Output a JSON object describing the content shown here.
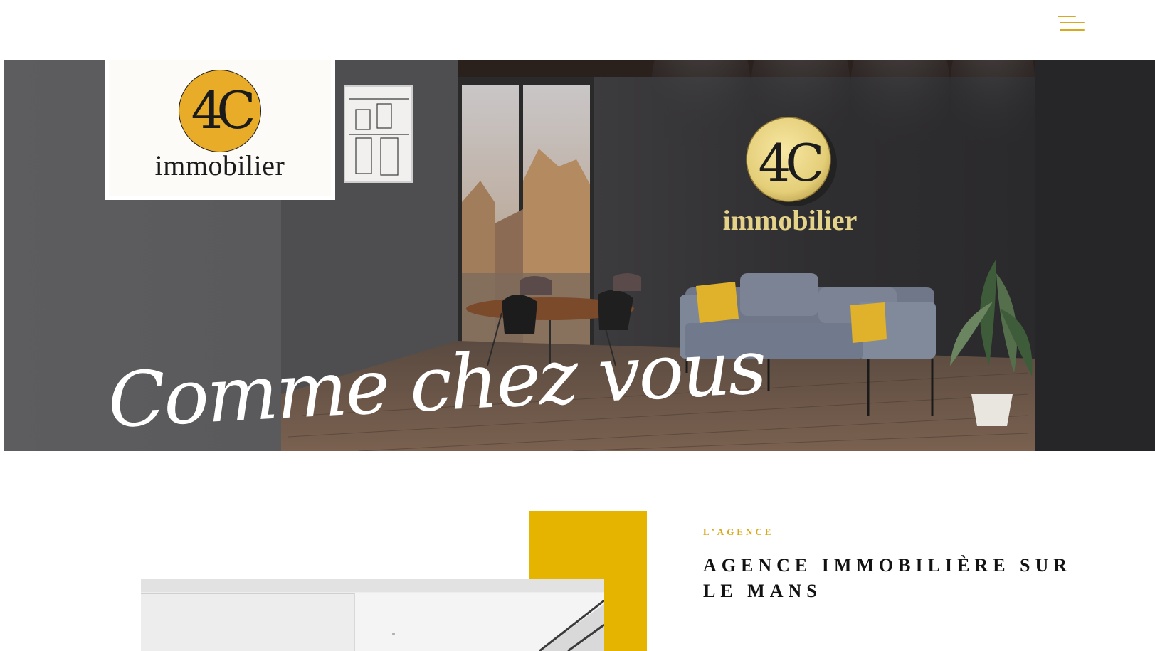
{
  "header": {
    "menu_icon": "hamburger-menu-icon",
    "accent_color": "#d7a91c"
  },
  "brand": {
    "logo_mark": "4C",
    "logo_word": "immobilier",
    "logo_color": "#e9ac29"
  },
  "hero": {
    "tagline": "Comme chez vous",
    "wall_logo_mark": "4C",
    "wall_logo_word": "immobilier"
  },
  "about": {
    "eyebrow": "L’AGENCE",
    "title": "AGENCE IMMOBILIÈRE SUR LE MANS",
    "block_color": "#e5b400"
  }
}
